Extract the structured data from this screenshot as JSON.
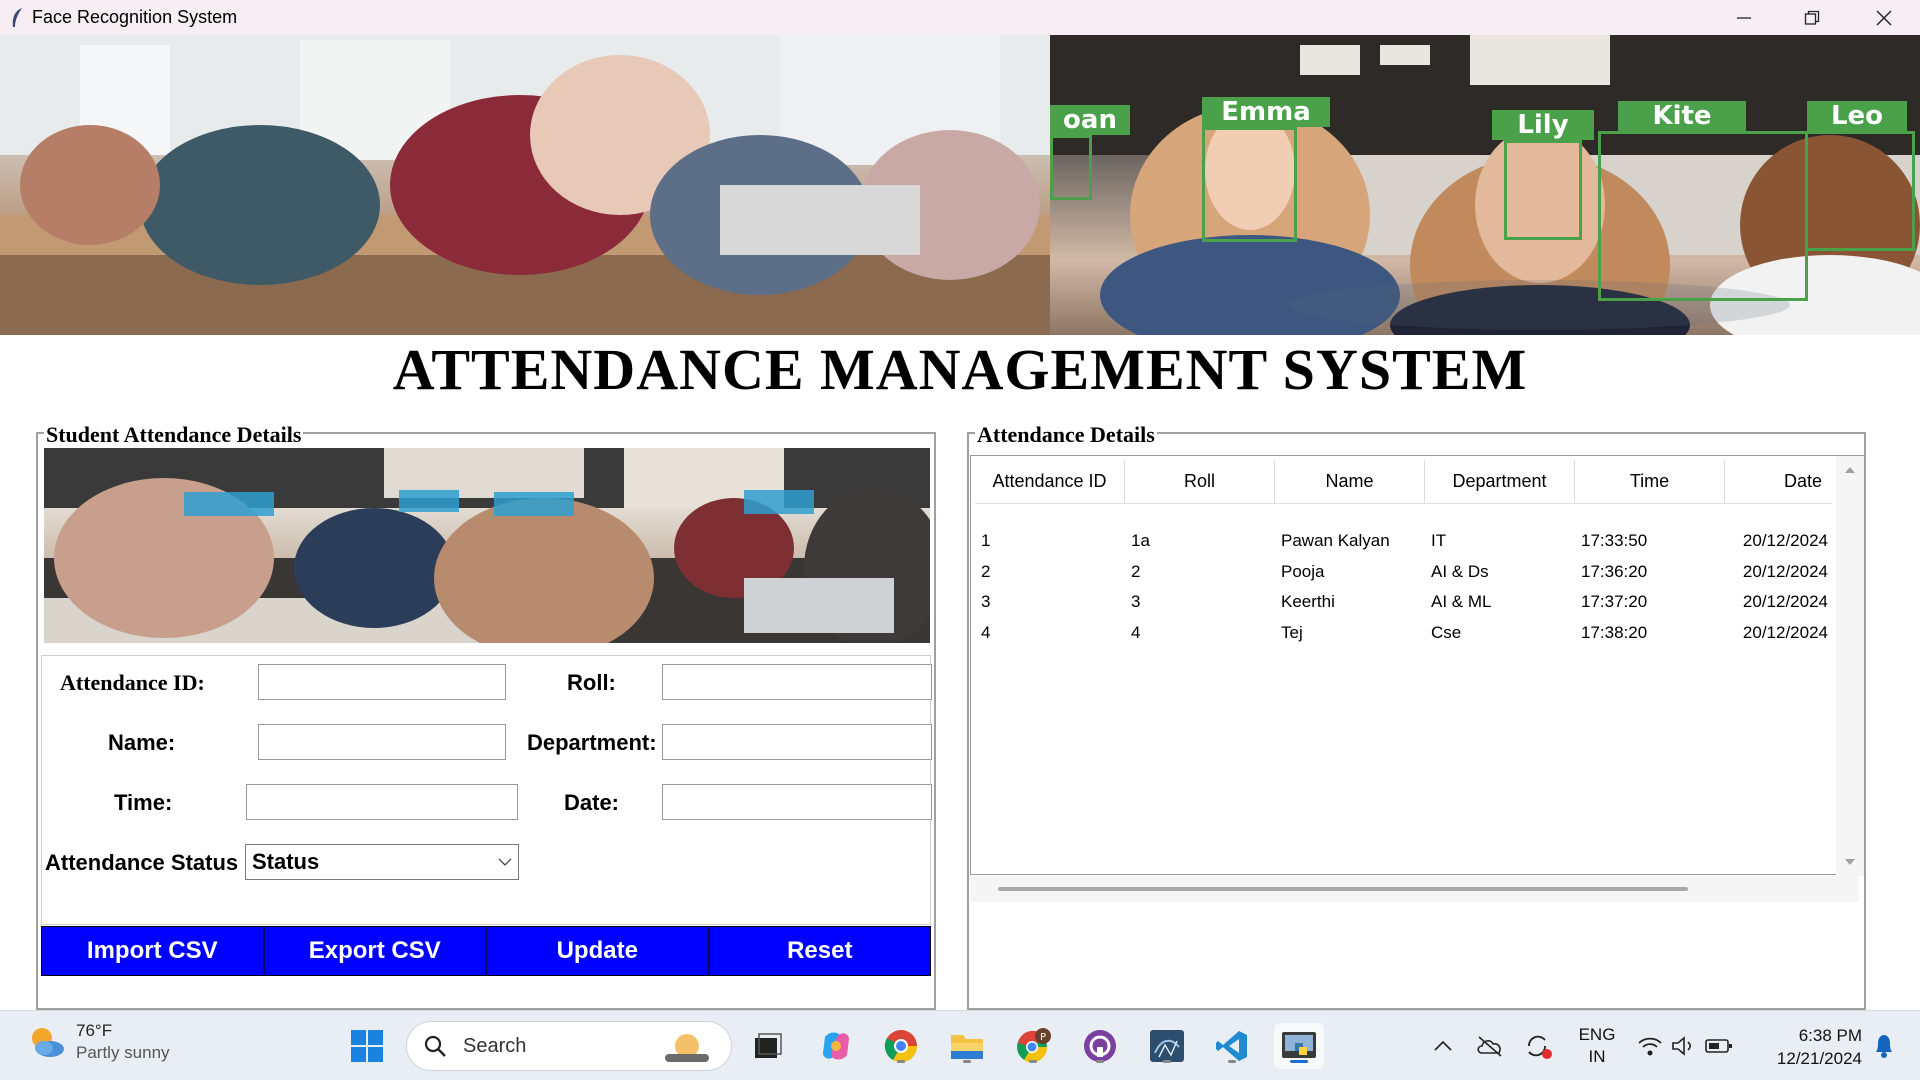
{
  "window": {
    "title": "Face Recognition System"
  },
  "banner": {
    "face_tags": [
      "oan",
      "Emma",
      "Lily",
      "Kite",
      "Leo"
    ]
  },
  "heading": "ATTENDANCE MANAGEMENT SYSTEM",
  "left_frame": {
    "label": "Student Attendance Details",
    "form": {
      "attendance_id_label": "Attendance ID:",
      "roll_label": "Roll:",
      "name_label": "Name:",
      "department_label": "Department:",
      "time_label": "Time:",
      "date_label": "Date:",
      "status_label": "Attendance Status",
      "status_value": "Status",
      "attendance_id_value": "",
      "roll_value": "",
      "name_value": "",
      "department_value": "",
      "time_value": "",
      "date_value": ""
    },
    "buttons": {
      "import": "Import CSV",
      "export": "Export CSV",
      "update": "Update",
      "reset": "Reset"
    }
  },
  "right_frame": {
    "label": "Attendance Details",
    "columns": [
      "Attendance ID",
      "Roll",
      "Name",
      "Department",
      "Time",
      "Date"
    ],
    "rows": [
      [
        "1",
        "1a",
        "Pawan Kalyan",
        "IT",
        "17:33:50",
        "20/12/2024"
      ],
      [
        "2",
        "2",
        "Pooja",
        "AI & Ds",
        "17:36:20",
        "20/12/2024"
      ],
      [
        "3",
        "3",
        "Keerthi",
        "AI & ML",
        "17:37:20",
        "20/12/2024"
      ],
      [
        "4",
        "4",
        "Tej",
        "Cse",
        "17:38:20",
        "20/12/2024"
      ]
    ]
  },
  "taskbar": {
    "weather_temp": "76°F",
    "weather_desc": "Partly sunny",
    "search_placeholder": "Search",
    "lang_top": "ENG",
    "lang_bottom": "IN",
    "time": "6:38 PM",
    "date": "12/21/2024"
  },
  "colors": {
    "button_blue": "#0000ff",
    "tag_green": "#4aa14a"
  }
}
